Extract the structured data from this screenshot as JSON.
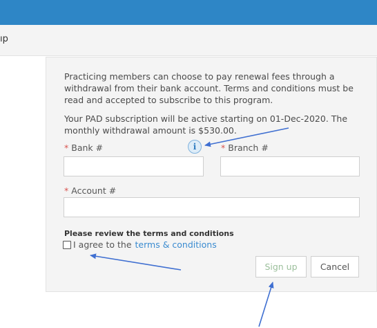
{
  "header": {
    "subbar_text": "ıp"
  },
  "intro": {
    "description": "Practicing members can choose to pay renewal fees through a withdrawal from their bank account. Terms and conditions must be read and accepted to subscribe to this program.",
    "subscription_note": "Your PAD subscription will be active starting on 01-Dec-2020. The monthly withdrawal amount is $530.00."
  },
  "form": {
    "required_marker": "*",
    "bank_label": "Bank #",
    "branch_label": "Branch #",
    "account_label": "Account #",
    "bank_value": "",
    "branch_value": "",
    "account_value": ""
  },
  "info_icon": {
    "glyph": "i"
  },
  "terms": {
    "title": "Please review the terms and conditions",
    "agree_text": "I agree to the",
    "link_text": "terms & conditions",
    "checked": false
  },
  "buttons": {
    "signup": "Sign up",
    "cancel": "Cancel"
  },
  "colors": {
    "header": "#2e86c6",
    "link": "#3a8bd0",
    "required": "#d9534f",
    "arrow": "#3f6fd1",
    "signup_text": "#9bbf9b"
  }
}
